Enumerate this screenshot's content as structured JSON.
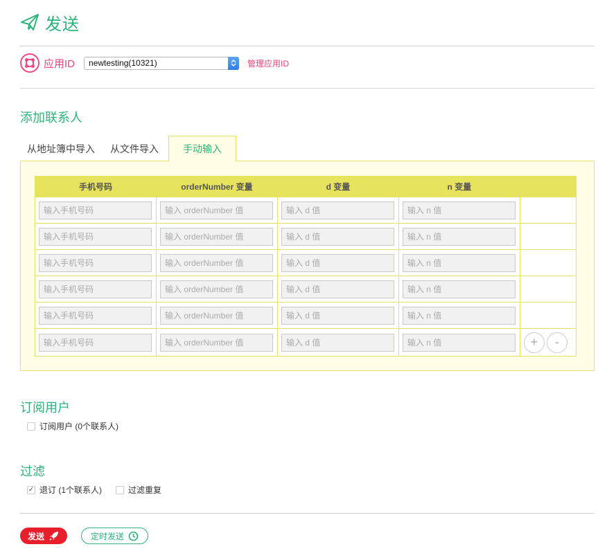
{
  "header": {
    "title": "发送",
    "icon": "paper-plane-icon",
    "accent": "#2db37a"
  },
  "app": {
    "label": "应用ID",
    "selected": "newtesting(10321)",
    "manage_link": "管理应用ID",
    "label_color": "#e8407b"
  },
  "contacts": {
    "title": "添加联系人",
    "tabs": [
      "从地址簿中导入",
      "从文件导入",
      "手动输入"
    ],
    "active_tab": "手动输入",
    "columns": [
      "手机号码",
      "orderNumber 变量",
      "d 变量",
      "n 变量"
    ],
    "placeholders": [
      "输入手机号码",
      "输入 orderNumber 值",
      "输入 d 值",
      "输入 n 值"
    ],
    "row_count": 6,
    "add_symbol": "+",
    "remove_symbol": "-"
  },
  "subscribers": {
    "title": "订阅用户",
    "checkbox_label": "订阅用户 (0个联系人)",
    "checked": false
  },
  "filter": {
    "title": "过滤",
    "options": [
      {
        "label": "退订 (1个联系人)",
        "checked": true
      },
      {
        "label": "过滤重复",
        "checked": false
      }
    ]
  },
  "actions": {
    "send_label": "发送",
    "schedule_label": "定时发送",
    "send_color": "#e81f2b"
  }
}
